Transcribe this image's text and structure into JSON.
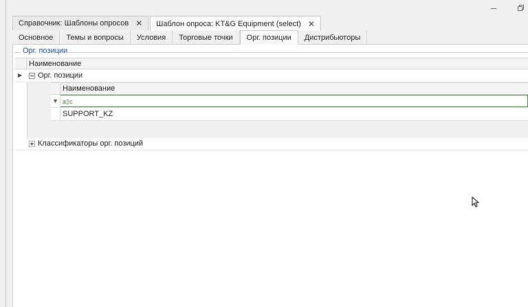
{
  "doc_tabs": [
    {
      "label": "Справочник: Шаблоны опросов",
      "close": "✕"
    },
    {
      "label": "Шаблон опроса:  KT&G Equipment (select)",
      "close": "✕"
    }
  ],
  "inner_tabs": [
    "Основное",
    "Темы и вопросы",
    "Условия",
    "Торговые точки",
    "Орг. позиции",
    "Дистрибьюторы"
  ],
  "group": {
    "caption": "Орг. позиции"
  },
  "grid": {
    "header": "Наименование",
    "main_row": "Орг. позиции",
    "detail": {
      "header": "Наименование",
      "filter_indicator": "▼",
      "filter_value": "a▯c",
      "rows": [
        "SUPPORT_KZ"
      ]
    },
    "classif_row": "Классификаторы орг. позиций"
  }
}
